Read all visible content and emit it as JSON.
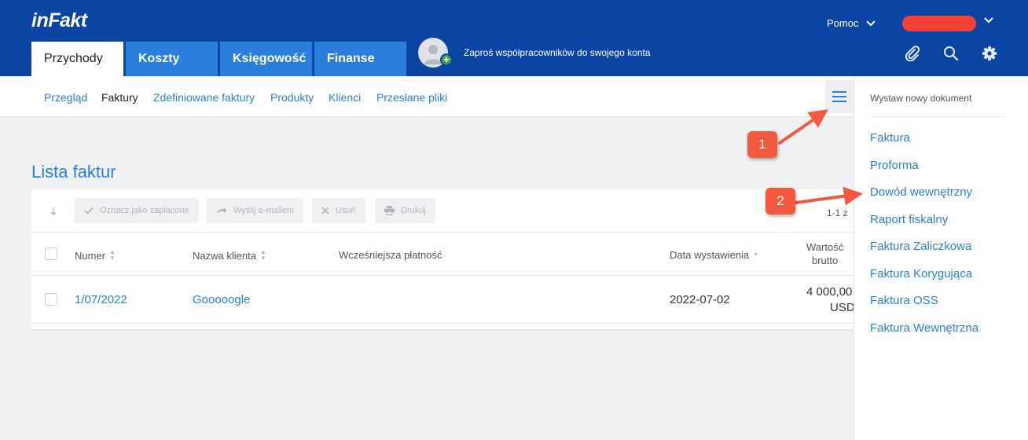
{
  "header": {
    "logo": "inFakt",
    "tabs": [
      "Przychody",
      "Koszty",
      "Księgowość",
      "Finanse"
    ],
    "invite_text": "Zaproś współpracowników do swojego konta",
    "help_label": "Pomoc"
  },
  "subnav": {
    "items": [
      "Przegląd",
      "Faktury",
      "Zdefiniowane faktury",
      "Produkty",
      "Klienci",
      "Przesłane pliki"
    ]
  },
  "main": {
    "title": "Lista faktur",
    "toolbar": {
      "mark_paid": "Oznacz jako zapłacone",
      "send_email": "Wyślij e-mailem",
      "delete": "Usuń",
      "print": "Drukuj"
    },
    "pagination": "1-1 z",
    "columns": {
      "number": "Numer",
      "client": "Nazwa klienta",
      "earlier_payment": "Wcześniejsza płatność",
      "issue_date": "Data wystawienia",
      "gross_line1": "Wartość",
      "gross_line2": "brutto"
    },
    "rows": [
      {
        "number": "1/07/2022",
        "client": "Gooooogle",
        "issue_date": "2022-07-02",
        "gross_amount": "4 000,00",
        "currency": "USD"
      }
    ]
  },
  "side_panel": {
    "heading": "Wystaw nowy dokument",
    "items": [
      "Faktura",
      "Proforma",
      "Dowód wewnętrzny",
      "Raport fiskalny",
      "Faktura Zaliczkowa",
      "Faktura Korygująca",
      "Faktura OSS",
      "Faktura Wewnętrzna"
    ]
  },
  "annotations": {
    "badge1": "1",
    "badge2": "2"
  },
  "colors": {
    "header": "#0b45a4",
    "tab": "#2b7fdc",
    "link": "#2b7fdc",
    "annotation": "#f3593e",
    "redaction": "#f44336"
  },
  "icons": [
    "paperclip-icon",
    "search-icon",
    "gear-icon",
    "hamburger-menu-icon",
    "chevron-down-icon",
    "check-icon",
    "share-arrow-icon",
    "close-icon",
    "printer-icon",
    "sort-icon"
  ]
}
